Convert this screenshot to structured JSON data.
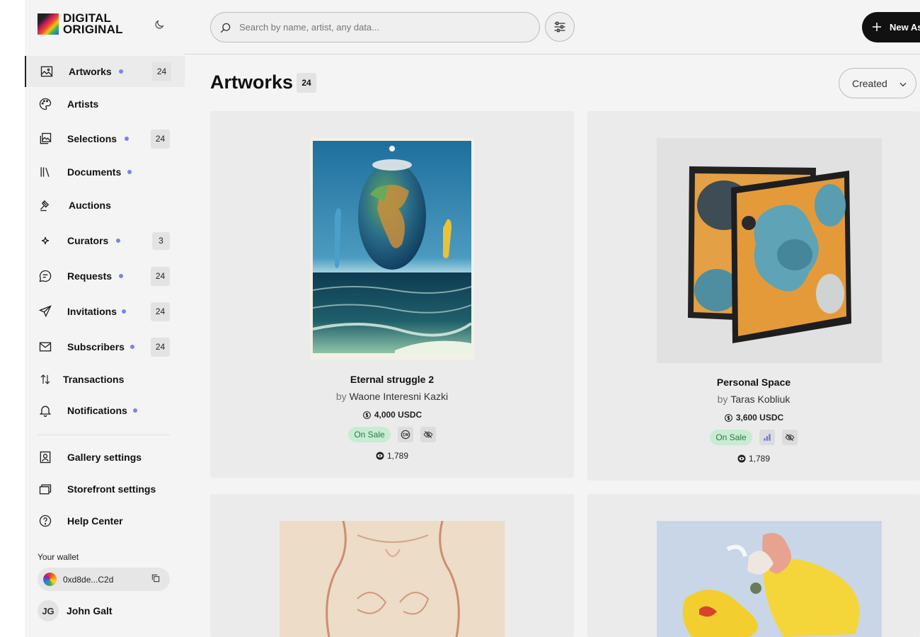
{
  "brand": {
    "line1": "DIGITAL",
    "line2": "ORIGINAL"
  },
  "sidebar": {
    "items": [
      {
        "label": "Artworks",
        "count": "24",
        "dot": true
      },
      {
        "label": "Artists",
        "count": "",
        "dot": false
      },
      {
        "label": "Selections",
        "count": "24",
        "dot": true
      },
      {
        "label": "Documents",
        "count": "",
        "dot": true
      },
      {
        "label": "Auctions",
        "count": "",
        "dot": false
      },
      {
        "label": "Curators",
        "count": "3",
        "dot": true
      },
      {
        "label": "Requests",
        "count": "24",
        "dot": true
      },
      {
        "label": "Invitations",
        "count": "24",
        "dot": true
      },
      {
        "label": "Subscribers",
        "count": "24",
        "dot": true
      },
      {
        "label": "Transactions",
        "count": "",
        "dot": false
      },
      {
        "label": "Notifications",
        "count": "",
        "dot": true
      }
    ],
    "settings": [
      {
        "label": "Gallery settings"
      },
      {
        "label": "Storefront settings"
      },
      {
        "label": "Help Center"
      }
    ],
    "wallet": {
      "label": "Your wallet",
      "address": "0xd8de...C2d"
    },
    "user": {
      "initials": "JG",
      "name": "John Galt"
    }
  },
  "topbar": {
    "search_placeholder": "Search by name, artist, any data...",
    "new_button_label": "New Asset"
  },
  "main": {
    "title": "Artworks",
    "count": "24",
    "sort_label": "Created",
    "cards": [
      {
        "title": "Eternal struggle 2",
        "by": "by",
        "artist": "Waone Interesni Kazki",
        "price": "4,000 USDC",
        "status": "On Sale",
        "views": "1,789"
      },
      {
        "title": "Personal Space",
        "by": "by",
        "artist": "Taras Kobliuk",
        "price": "3,600 USDC",
        "status": "On Sale",
        "views": "1,789"
      }
    ]
  },
  "colors": {
    "accent_dot": "#7b82e8",
    "sale_bg": "#c8ecd2",
    "sale_text": "#2b7a45",
    "dark": "#111111"
  }
}
